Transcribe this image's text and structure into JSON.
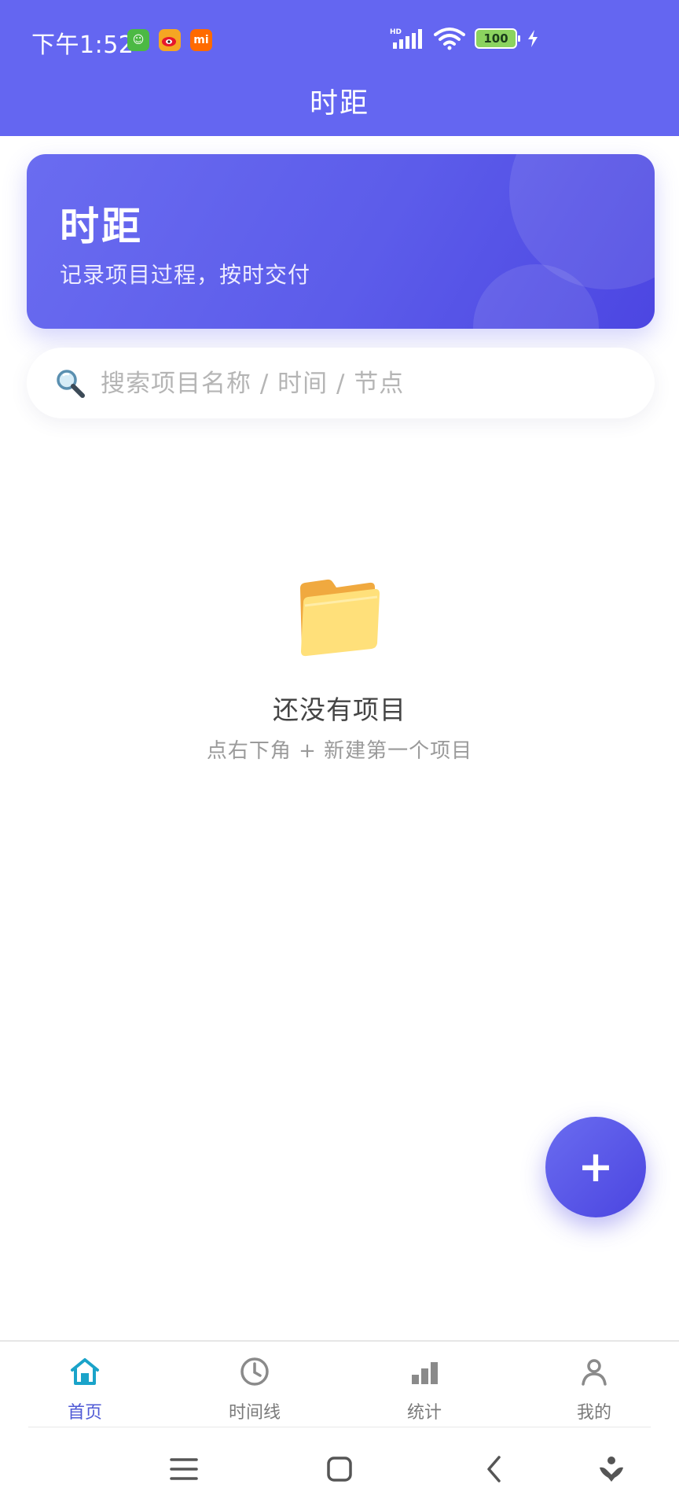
{
  "status_bar": {
    "time": "下午1:52",
    "battery": "100",
    "network": "HD"
  },
  "app_bar": {
    "title": "时距"
  },
  "hero": {
    "title": "时距",
    "subtitle": "记录项目过程，按时交付"
  },
  "search": {
    "placeholder": "搜索项目名称 / 时间 / 节点"
  },
  "empty_state": {
    "title": "还没有项目",
    "hint": "点右下角 + 新建第一个项目"
  },
  "fab": {
    "label": "+"
  },
  "tabs": [
    {
      "label": "首页",
      "icon": "home-icon",
      "active": true
    },
    {
      "label": "时间线",
      "icon": "clock-icon",
      "active": false
    },
    {
      "label": "统计",
      "icon": "bar-chart-icon",
      "active": false
    },
    {
      "label": "我的",
      "icon": "user-icon",
      "active": false
    }
  ],
  "colors": {
    "primary": "#6466F1",
    "primary_dark": "#4B45E0",
    "active_tab_icon": "#1AA3C9",
    "active_tab_label": "#4F5AD6"
  }
}
